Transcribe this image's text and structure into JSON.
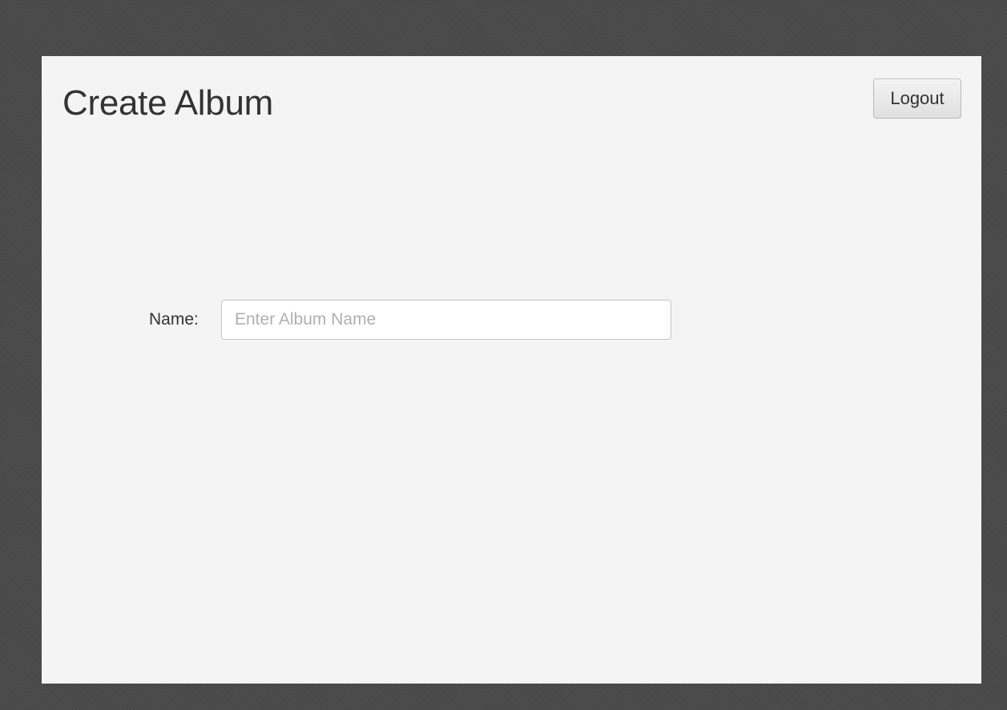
{
  "header": {
    "title": "Create Album",
    "logout_label": "Logout"
  },
  "form": {
    "name_label": "Name:",
    "name_value": "",
    "name_placeholder": "Enter Album Name"
  },
  "colors": {
    "backdrop": "#4a4a4a",
    "window_background": "#f4f4f4",
    "text": "#333333",
    "placeholder": "#b0b0b0"
  }
}
